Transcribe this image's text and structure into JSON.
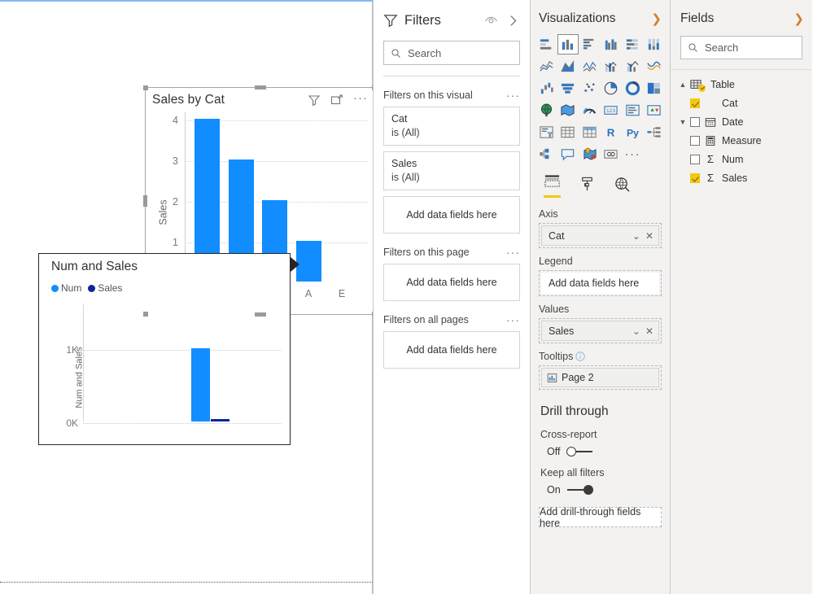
{
  "canvas": {
    "visual": {
      "title": "Sales by Cat",
      "icons": [
        "filter-icon",
        "focus-mode-icon",
        "more-options-icon"
      ]
    },
    "tooltip_visual": {
      "title": "Num and Sales",
      "legend": [
        {
          "label": "Num",
          "color": "#118DFF"
        },
        {
          "label": "Sales",
          "color": "#12239E"
        }
      ]
    }
  },
  "chart_data": [
    {
      "type": "bar",
      "title": "Sales by Cat",
      "categories": [
        "",
        "",
        "",
        "A",
        "E"
      ],
      "values": [
        4,
        3,
        2,
        1,
        0
      ],
      "xlabel": "",
      "ylabel": "Sales",
      "yticks": [
        "1",
        "2",
        "3",
        "4"
      ],
      "ylim": [
        0,
        4.4
      ],
      "grid": true,
      "series_color": "#118DFF",
      "visible_xticks": [
        "A",
        "E"
      ]
    },
    {
      "type": "bar",
      "title": "Num and Sales",
      "categories": [
        ""
      ],
      "series": [
        {
          "name": "Num",
          "values": [
            1000
          ],
          "color": "#118DFF"
        },
        {
          "name": "Sales",
          "values": [
            10
          ],
          "color": "#12239E"
        }
      ],
      "xlabel": "",
      "ylabel": "Num and Sales",
      "yticks": [
        "0K",
        "1K"
      ],
      "ylim": [
        0,
        1100
      ],
      "grid": true,
      "legend_position": "top"
    }
  ],
  "filters": {
    "title": "Filters",
    "search_placeholder": "Search",
    "sections": [
      {
        "heading": "Filters on this visual",
        "cards": [
          {
            "field": "Cat",
            "condition": "is (All)"
          },
          {
            "field": "Sales",
            "condition": "is (All)"
          }
        ],
        "dropzone": "Add data fields here"
      },
      {
        "heading": "Filters on this page",
        "cards": [],
        "dropzone": "Add data fields here"
      },
      {
        "heading": "Filters on all pages",
        "cards": [],
        "dropzone": "Add data fields here"
      }
    ]
  },
  "visualizations": {
    "title": "Visualizations",
    "gallery": [
      "stacked-bar-chart-icon",
      "stacked-column-chart-icon",
      "clustered-bar-chart-icon",
      "clustered-column-chart-icon",
      "100-stacked-bar-chart-icon",
      "100-stacked-column-chart-icon",
      "line-chart-icon",
      "area-chart-icon",
      "stacked-area-chart-icon",
      "line-and-stacked-column-chart-icon",
      "line-and-clustered-column-chart-icon",
      "ribbon-chart-icon",
      "waterfall-chart-icon",
      "funnel-chart-icon",
      "scatter-chart-icon",
      "pie-chart-icon",
      "donut-chart-icon",
      "treemap-icon",
      "map-icon",
      "filled-map-icon",
      "gauge-icon",
      "card-icon",
      "multi-row-card-icon",
      "kpi-icon",
      "slicer-icon",
      "table-icon",
      "matrix-icon",
      "r-script-visual-icon",
      "python-visual-icon",
      "decomposition-tree-icon",
      "key-influencers-icon",
      "smart-narrative-icon",
      "arcgis-maps-icon",
      "paginated-report-icon",
      "more-visuals-icon"
    ],
    "selected_gallery_index": 1,
    "tabs": [
      "fields-pane-icon",
      "format-pane-icon",
      "analytics-pane-icon"
    ],
    "active_tab_index": 0,
    "wells": [
      {
        "label": "Axis",
        "type": "pill",
        "value": "Cat"
      },
      {
        "label": "Legend",
        "type": "empty",
        "value": "Add data fields here"
      },
      {
        "label": "Values",
        "type": "pill",
        "value": "Sales"
      },
      {
        "label": "Tooltips",
        "type": "tooltip",
        "value": "Page 2",
        "has_info": true
      }
    ],
    "drill": {
      "heading": "Drill through",
      "cross_report": {
        "label": "Cross-report",
        "state": "Off",
        "on": false
      },
      "keep_all_filters": {
        "label": "Keep all filters",
        "state": "On",
        "on": true
      },
      "dropzone": "Add drill-through fields here"
    }
  },
  "fields": {
    "title": "Fields",
    "search_placeholder": "Search",
    "tree": [
      {
        "label": "Table",
        "level": 0,
        "expanded": true,
        "icon": "table-icon",
        "checkbox": "table-checked",
        "chevron": "up"
      },
      {
        "label": "Cat",
        "level": 1,
        "checked": true,
        "icon": "none",
        "chevron": "none"
      },
      {
        "label": "Date",
        "level": 1,
        "checked": false,
        "icon": "calendar-icon",
        "chevron": "down"
      },
      {
        "label": "Measure",
        "level": 1,
        "checked": false,
        "icon": "calculator-icon",
        "chevron": "none"
      },
      {
        "label": "Num",
        "level": 1,
        "checked": false,
        "icon": "sigma-icon",
        "chevron": "none"
      },
      {
        "label": "Sales",
        "level": 1,
        "checked": true,
        "icon": "sigma-icon",
        "chevron": "none"
      }
    ]
  },
  "colors": {
    "accent_blue": "#118DFF",
    "dark_blue": "#12239E",
    "powerbi_yellow": "#F2C811",
    "pane_bg": "#F3F2F1"
  }
}
